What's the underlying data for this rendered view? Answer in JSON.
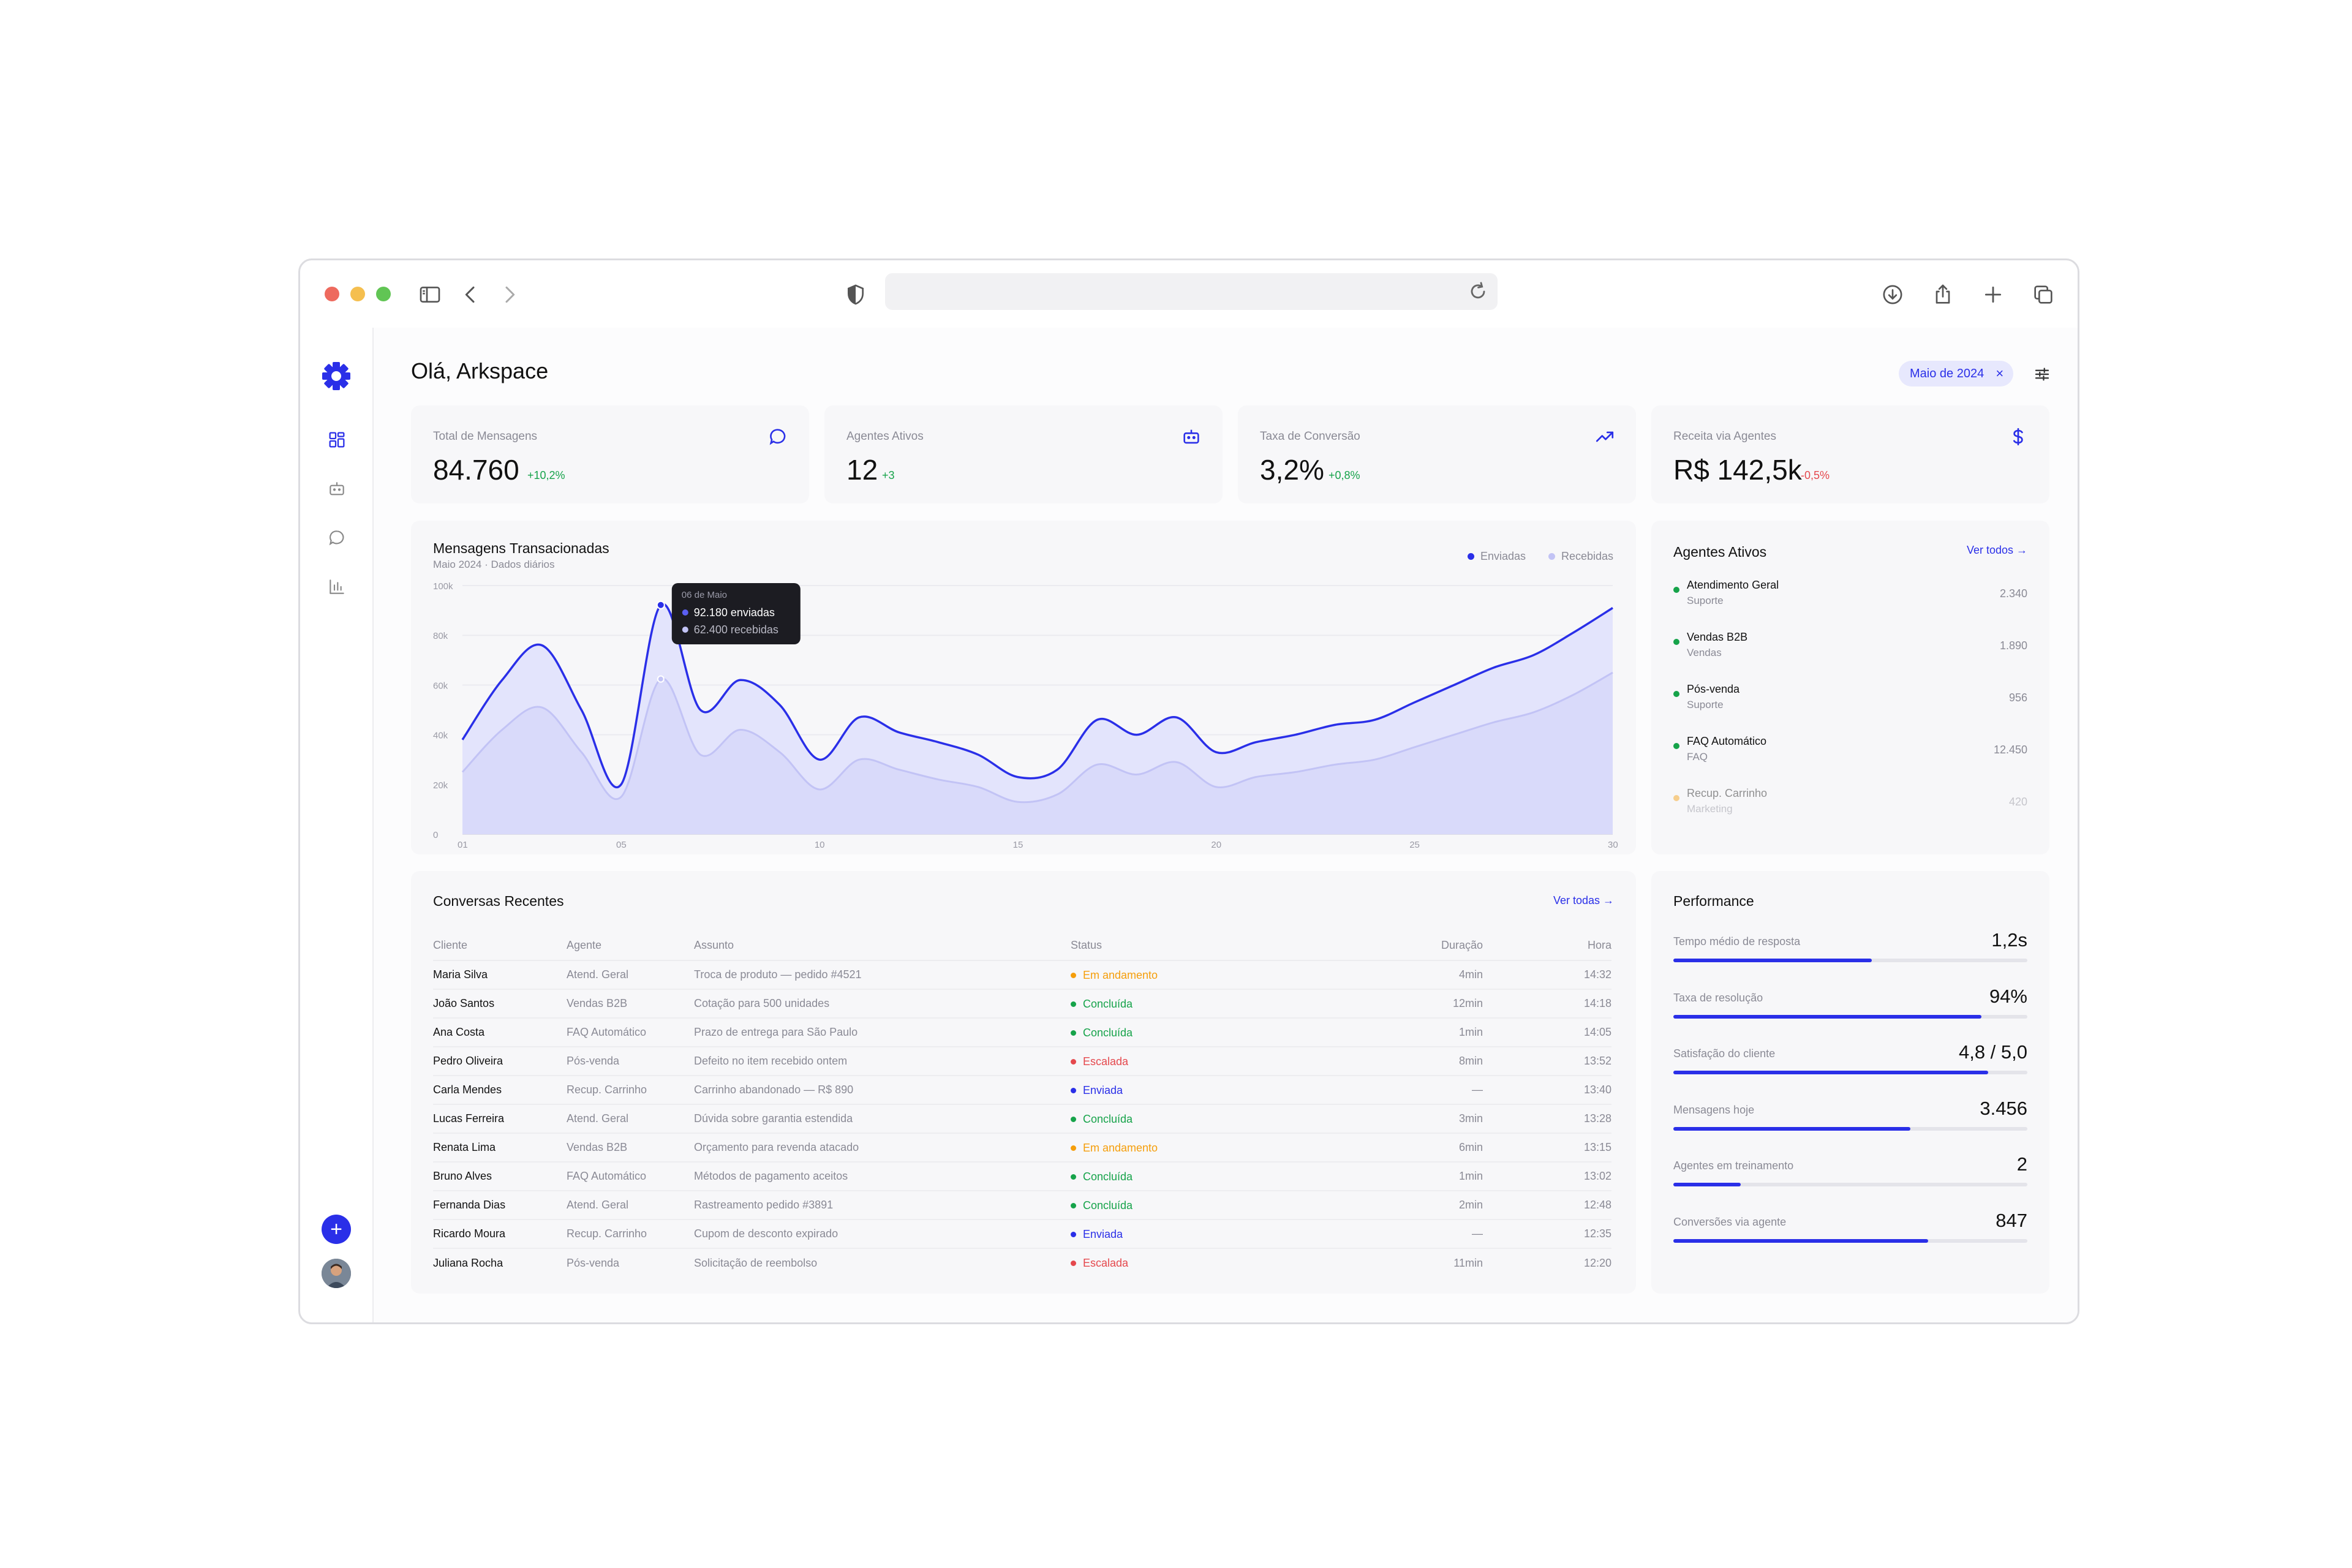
{
  "browser": {
    "icons": [
      "sidebar-icon",
      "back-icon",
      "forward-icon",
      "shield-icon",
      "reload-icon",
      "download-icon",
      "share-icon",
      "plus-icon",
      "tabs-icon"
    ]
  },
  "header": {
    "greeting": "Olá, Arkspace",
    "filter_chip": "Maio de 2024",
    "chip_close": "×"
  },
  "nav": {
    "items": [
      "dashboard-icon",
      "agents-icon",
      "chat-icon",
      "chart-icon"
    ],
    "fab_label": "+"
  },
  "colors": {
    "accent": "#2a2fe8",
    "positive": "#16a34a",
    "negative": "#e5484d",
    "warning": "#f59e0b",
    "recebidas": "#c2c3f5"
  },
  "kpis": [
    {
      "label": "Total de Mensagens",
      "value": "84.760",
      "delta": "+10,2%",
      "trend": "up",
      "icon": "chat-bubble-icon"
    },
    {
      "label": "Agentes Ativos",
      "value": "12",
      "delta": "+3",
      "trend": "up",
      "icon": "robot-icon"
    },
    {
      "label": "Taxa de Conversão",
      "value": "3,2%",
      "delta": "+0,8%",
      "trend": "up",
      "icon": "trend-up-icon"
    },
    {
      "label": "Receita via Agentes",
      "value": "R$ 142,5k",
      "delta": "-0,5%",
      "trend": "down",
      "icon": "dollar-icon"
    }
  ],
  "chart_card": {
    "title": "Mensagens Transacionadas",
    "subtitle": "Maio 2024 · Dados diários",
    "legend": [
      "Enviadas",
      "Recebidas"
    ],
    "tooltip": {
      "date": "06 de Maio",
      "line1": "92.180 enviadas",
      "line2": "62.400 recebidas"
    }
  },
  "chart_data": {
    "type": "area",
    "x": [
      1,
      2,
      3,
      4,
      5,
      6,
      7,
      8,
      9,
      10,
      11,
      12,
      13,
      14,
      15,
      16,
      17,
      18,
      19,
      20,
      21,
      22,
      23,
      24,
      25,
      26,
      27,
      28,
      29,
      30
    ],
    "series": [
      {
        "name": "Enviadas",
        "values": [
          38000,
          62000,
          76000,
          50000,
          20000,
          92180,
          50000,
          62000,
          52000,
          30000,
          47000,
          41000,
          37000,
          32000,
          23000,
          26000,
          46000,
          40000,
          47000,
          33000,
          37000,
          40000,
          44000,
          46000,
          53000,
          60000,
          67000,
          72000,
          81000,
          91000
        ]
      },
      {
        "name": "Recebidas",
        "values": [
          25000,
          42000,
          51000,
          33000,
          15000,
          62400,
          32000,
          42000,
          33000,
          18000,
          30000,
          26000,
          22000,
          19000,
          13000,
          16000,
          28000,
          24000,
          29000,
          19000,
          23000,
          25000,
          28000,
          30000,
          35000,
          40000,
          45000,
          49000,
          56000,
          65000
        ]
      }
    ],
    "ylim": [
      0,
      100000
    ],
    "yticks": [
      "0",
      "20k",
      "40k",
      "60k",
      "80k",
      "100k"
    ],
    "xticks": [
      "01",
      "05",
      "10",
      "15",
      "20",
      "25",
      "30"
    ],
    "xtick_values": [
      1,
      5,
      10,
      15,
      20,
      25,
      30
    ],
    "grid": true,
    "legend_position": "top-right"
  },
  "agents_card": {
    "title": "Agentes Ativos",
    "link": "Ver todos →",
    "items": [
      {
        "name": "Atendimento Geral",
        "category": "Suporte",
        "value": "2.340",
        "status": "active"
      },
      {
        "name": "Vendas B2B",
        "category": "Vendas",
        "value": "1.890",
        "status": "active"
      },
      {
        "name": "Pós-venda",
        "category": "Suporte",
        "value": "956",
        "status": "active"
      },
      {
        "name": "FAQ Automático",
        "category": "FAQ",
        "value": "12.450",
        "status": "active"
      },
      {
        "name": "Recup. Carrinho",
        "category": "Marketing",
        "value": "420",
        "status": "paused"
      }
    ]
  },
  "conversations": {
    "title": "Conversas Recentes",
    "link": "Ver todas →",
    "columns": [
      "Cliente",
      "Agente",
      "Assunto",
      "Status",
      "Duração",
      "Hora"
    ],
    "rows": [
      {
        "client": "Maria Silva",
        "agent": "Atend. Geral",
        "subject": "Troca de produto — pedido #4521",
        "status": "Em andamento",
        "kind": "progress",
        "duration": "4min",
        "time": "14:32"
      },
      {
        "client": "João Santos",
        "agent": "Vendas B2B",
        "subject": "Cotação para 500 unidades",
        "status": "Concluída",
        "kind": "done",
        "duration": "12min",
        "time": "14:18"
      },
      {
        "client": "Ana Costa",
        "agent": "FAQ Automático",
        "subject": "Prazo de entrega para São Paulo",
        "status": "Concluída",
        "kind": "done",
        "duration": "1min",
        "time": "14:05"
      },
      {
        "client": "Pedro Oliveira",
        "agent": "Pós-venda",
        "subject": "Defeito no item recebido ontem",
        "status": "Escalada",
        "kind": "escalated",
        "duration": "8min",
        "time": "13:52"
      },
      {
        "client": "Carla Mendes",
        "agent": "Recup. Carrinho",
        "subject": "Carrinho abandonado — R$ 890",
        "status": "Enviada",
        "kind": "sent",
        "duration": "—",
        "time": "13:40"
      },
      {
        "client": "Lucas Ferreira",
        "agent": "Atend. Geral",
        "subject": "Dúvida sobre garantia estendida",
        "status": "Concluída",
        "kind": "done",
        "duration": "3min",
        "time": "13:28"
      },
      {
        "client": "Renata Lima",
        "agent": "Vendas B2B",
        "subject": "Orçamento para revenda atacado",
        "status": "Em andamento",
        "kind": "progress",
        "duration": "6min",
        "time": "13:15"
      },
      {
        "client": "Bruno Alves",
        "agent": "FAQ Automático",
        "subject": "Métodos de pagamento aceitos",
        "status": "Concluída",
        "kind": "done",
        "duration": "1min",
        "time": "13:02"
      },
      {
        "client": "Fernanda Dias",
        "agent": "Atend. Geral",
        "subject": "Rastreamento pedido #3891",
        "status": "Concluída",
        "kind": "done",
        "duration": "2min",
        "time": "12:48"
      },
      {
        "client": "Ricardo Moura",
        "agent": "Recup. Carrinho",
        "subject": "Cupom de desconto expirado",
        "status": "Enviada",
        "kind": "sent",
        "duration": "—",
        "time": "12:35"
      },
      {
        "client": "Juliana Rocha",
        "agent": "Pós-venda",
        "subject": "Solicitação de reembolso",
        "status": "Escalada",
        "kind": "escalated",
        "duration": "11min",
        "time": "12:20"
      }
    ]
  },
  "performance": {
    "title": "Performance",
    "metrics": [
      {
        "label": "Tempo médio de resposta",
        "value": "1,2s",
        "progress": 0.56
      },
      {
        "label": "Taxa de resolução",
        "value": "94%",
        "progress": 0.87
      },
      {
        "label": "Satisfação do cliente",
        "value": "4,8 / 5,0",
        "progress": 0.89
      },
      {
        "label": "Mensagens hoje",
        "value": "3.456",
        "progress": 0.67
      },
      {
        "label": "Agentes em treinamento",
        "value": "2",
        "progress": 0.19
      },
      {
        "label": "Conversões via agente",
        "value": "847",
        "progress": 0.72
      }
    ]
  }
}
